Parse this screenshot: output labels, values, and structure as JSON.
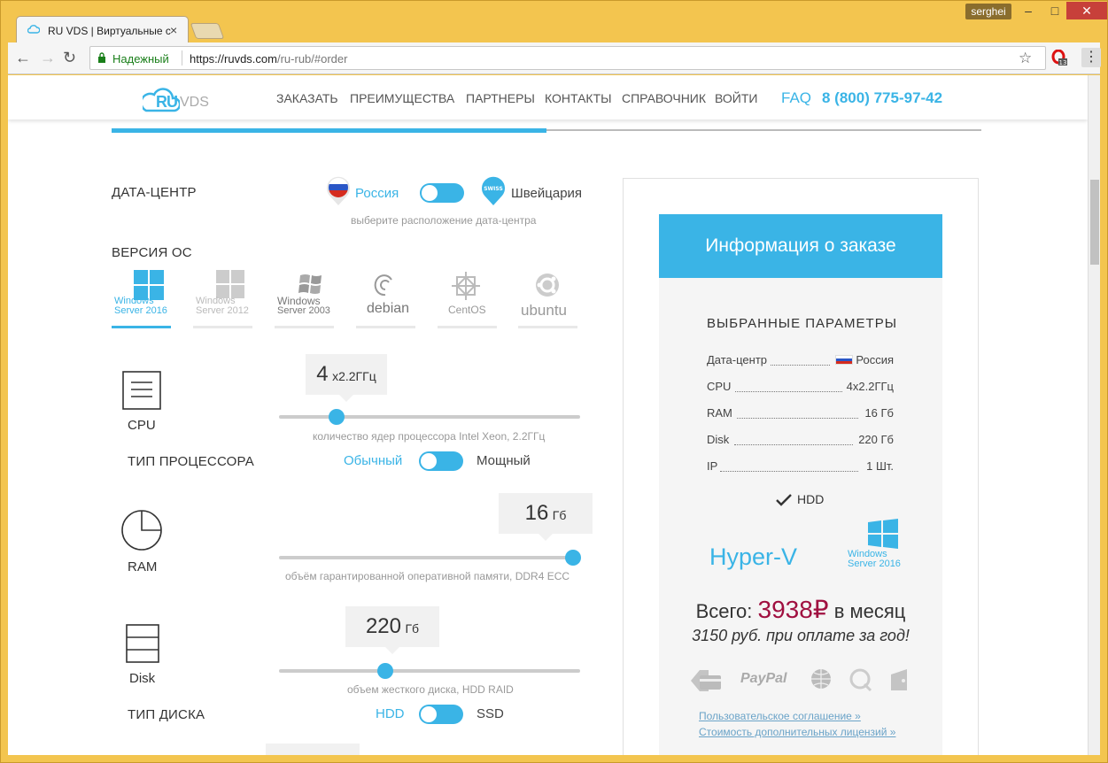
{
  "browser": {
    "tab_title": "RU VDS | Виртуальные с",
    "tab_close": "×",
    "user": "serghei",
    "secure_label": "Надежный",
    "url_host": "https://ruvds.com",
    "url_path": "/ru-rub/#order",
    "opera_badge": "13"
  },
  "header": {
    "nav": [
      "ЗАКАЗАТЬ",
      "ПРЕИМУЩЕСТВА",
      "ПАРТНЕРЫ",
      "КОНТАКТЫ",
      "СПРАВОЧНИК",
      "ВОЙТИ"
    ],
    "faq": "FAQ",
    "phone": "8 (800) 775-97-42",
    "logo_ru": "RU",
    "logo_vds": "VDS"
  },
  "step_progress": 0.5,
  "datacenter": {
    "label": "ДАТА-ЦЕНТР",
    "opt_russia": "Россия",
    "opt_swiss": "Швейцария",
    "swiss_badge": "SWISS",
    "hint": "выберите расположение дата-центра"
  },
  "os": {
    "label": "ВЕРСИЯ ОС",
    "items": [
      {
        "line1": "Windows",
        "line2": "Server 2016"
      },
      {
        "line1": "Windows",
        "line2": "Server 2012"
      },
      {
        "line1": "Windows",
        "line2": "Server 2003"
      },
      {
        "name": "debian"
      },
      {
        "name": "CentOS"
      },
      {
        "name": "ubuntu"
      }
    ]
  },
  "cpu": {
    "label": "CPU",
    "value": "4",
    "unit": "x2.2ГГц",
    "hint": "количество ядер процессора Intel Xeon, 2.2ГГц",
    "type_label": "ТИП ПРОЦЕССОРА",
    "type_opt1": "Обычный",
    "type_opt2": "Мощный"
  },
  "ram": {
    "label": "RAM",
    "value": "16",
    "unit": "Гб",
    "hint": "объём гарантированной оперативной памяти, DDR4 ECC"
  },
  "disk": {
    "label": "Disk",
    "value": "220",
    "unit": "Гб",
    "hint": "объем жесткого диска, HDD RAID",
    "type_label": "ТИП ДИСКА",
    "type_opt1": "HDD",
    "type_opt2": "SSD"
  },
  "order": {
    "title": "Информация о заказе",
    "params_title": "ВЫБРАННЫЕ ПАРАМЕТРЫ",
    "params": [
      {
        "name": "Дата-центр",
        "value": "Россия"
      },
      {
        "name": "CPU",
        "value": "4x2.2ГГц"
      },
      {
        "name": "RAM",
        "value": "16 Гб"
      },
      {
        "name": "Disk",
        "value": "220 Гб"
      },
      {
        "name": "IP",
        "value": "1 Шт."
      }
    ],
    "hdd": "HDD",
    "hyperv": "Hyper-V",
    "win_line1": "Windows",
    "win_line2": "Server 2016",
    "total_prefix": "Всего:",
    "total_price": "3938₽",
    "total_suffix": "в месяц",
    "annual": "3150 руб. при оплате за год!",
    "paypal": "PayPal",
    "link_agreement": "Пользовательское соглашение »",
    "link_licenses": "Стоимость дополнительных лицензий »"
  },
  "colors": {
    "accent": "#3ab4e6",
    "price": "#a01040",
    "window_frame": "#f3c54f"
  }
}
